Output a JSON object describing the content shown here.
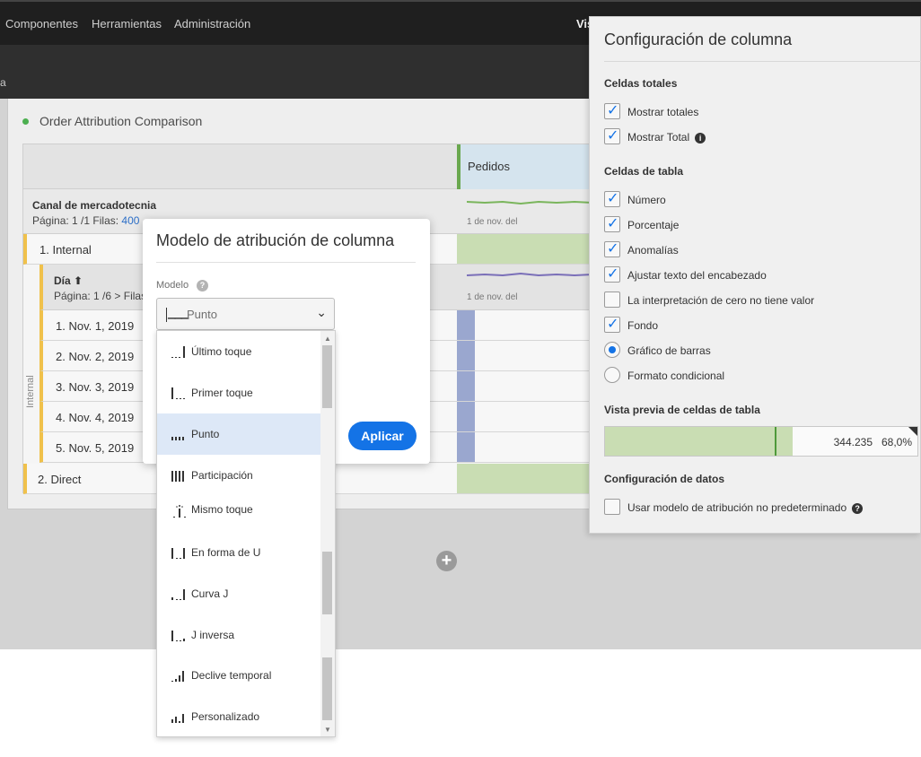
{
  "nav": {
    "items": [
      "Componentes",
      "Herramientas",
      "Administración"
    ],
    "right_partial": "Vis"
  },
  "panel": {
    "title": "Order Attribution Comparison"
  },
  "table": {
    "metric": "Pedidos",
    "dimension": "Canal de mercadotecnia",
    "page_info": "Página: 1 /1",
    "rows_label": "Filas:",
    "rows_value": "400",
    "spark_label": "1 de nov. del",
    "rows": [
      "1. Internal",
      "2. Direct"
    ],
    "sub_dimension": "Día ⬆",
    "sub_page_info": "Página: 1 /6 >",
    "sub_rows_label": "Filas:",
    "sub_rows": [
      "1. Nov. 1, 2019",
      "2. Nov. 2, 2019",
      "3. Nov. 3, 2019",
      "4. Nov. 4, 2019",
      "5. Nov. 5, 2019"
    ],
    "vertical_label": "Internal"
  },
  "config": {
    "title": "Configuración de columna",
    "section_totals": "Celdas totales",
    "show_totals": "Mostrar totales",
    "show_total": "Mostrar Total",
    "section_cells": "Celdas de tabla",
    "number": "Número",
    "percent": "Porcentaje",
    "anomalies": "Anomalías",
    "wrap_header": "Ajustar texto del encabezado",
    "zero_no_value": "La interpretación de cero no tiene valor",
    "background": "Fondo",
    "bar_chart": "Gráfico de barras",
    "conditional": "Formato condicional",
    "section_preview": "Vista previa de celdas de tabla",
    "preview_value": "344.235",
    "preview_percent": "68,0%",
    "preview_fill": 0.68,
    "section_data": "Configuración de datos",
    "non_default_model": "Usar modelo de atribución no predeterminado"
  },
  "modal": {
    "title": "Modelo de atribución de columna",
    "model_label": "Modelo",
    "selected": "Punto",
    "apply": "Aplicar",
    "options": [
      "Último toque",
      "Primer toque",
      "Punto",
      "Participación",
      "Mismo toque",
      "En forma de U",
      "Curva J",
      "J inversa",
      "Declive temporal",
      "Personalizado"
    ]
  }
}
